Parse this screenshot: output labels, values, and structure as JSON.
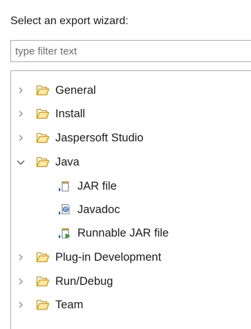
{
  "prompt_label": "Select an export wizard:",
  "filter": {
    "placeholder": "type filter text",
    "value": ""
  },
  "tree": {
    "items": [
      {
        "label": "General",
        "expanded": false,
        "icon": "folder-icon"
      },
      {
        "label": "Install",
        "expanded": false,
        "icon": "folder-icon"
      },
      {
        "label": "Jaspersoft Studio",
        "expanded": false,
        "icon": "folder-icon"
      },
      {
        "label": "Java",
        "expanded": true,
        "icon": "folder-icon",
        "children": [
          {
            "label": "JAR file",
            "icon": "jar-file-icon"
          },
          {
            "label": "Javadoc",
            "icon": "javadoc-icon"
          },
          {
            "label": "Runnable JAR file",
            "icon": "runnable-jar-icon"
          }
        ]
      },
      {
        "label": "Plug-in Development",
        "expanded": false,
        "icon": "folder-icon"
      },
      {
        "label": "Run/Debug",
        "expanded": false,
        "icon": "folder-icon"
      },
      {
        "label": "Team",
        "expanded": false,
        "icon": "folder-icon"
      }
    ]
  },
  "colors": {
    "folder_stroke": "#c8951f",
    "folder_fill": "#fde9a3",
    "arrow": "#8a8a8a",
    "border": "#adadad",
    "export_arrow": "#1f5fae"
  }
}
